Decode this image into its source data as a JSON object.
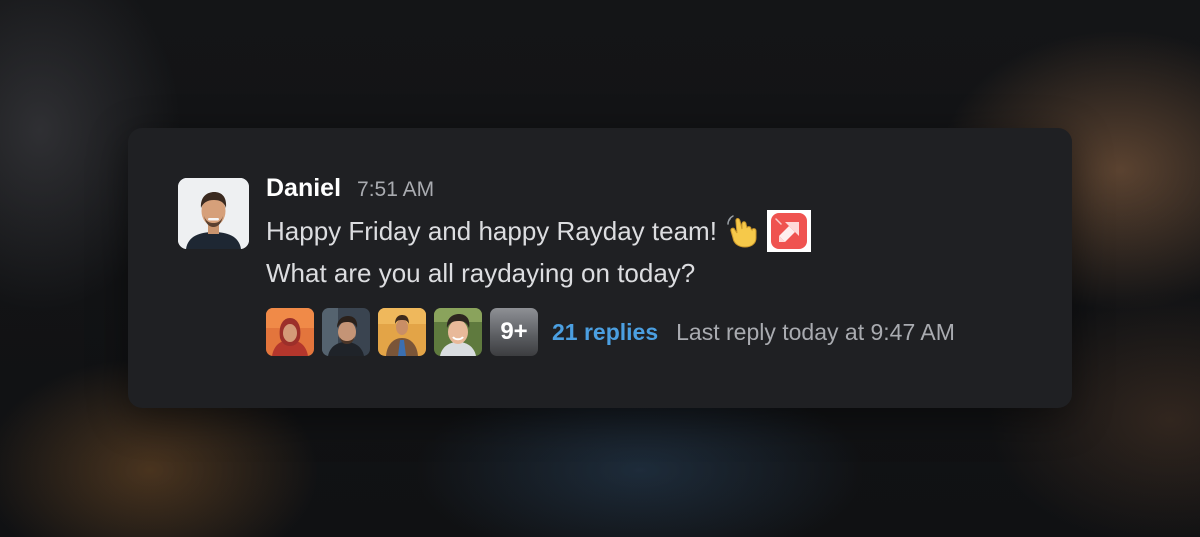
{
  "message": {
    "author": "Daniel",
    "time": "7:51 AM",
    "lines": [
      "Happy Friday and happy Rayday team!",
      "What are you all raydaying on today?"
    ],
    "emojis": [
      "waving-hand-emoji",
      "raycast-logo-emoji"
    ]
  },
  "thread": {
    "participants": [
      "participant-1",
      "participant-2",
      "participant-3",
      "participant-4"
    ],
    "more_label": "9+",
    "replies_label": "21 replies",
    "last_reply_label": "Last reply today at 9:47 AM"
  },
  "colors": {
    "card_background": "#1f2023",
    "author_text": "#ffffff",
    "message_text": "#dcdde0",
    "muted_text": "#a9abb0",
    "link_blue": "#4b9fe1",
    "raycast_red": "#ef5350"
  }
}
